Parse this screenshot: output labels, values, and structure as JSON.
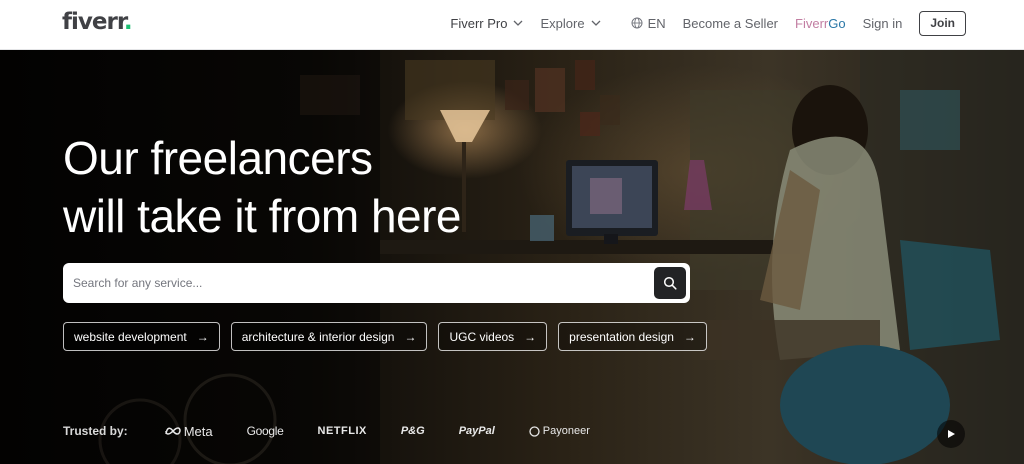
{
  "header": {
    "logo_text": "fiverr",
    "logo_dot": ".",
    "nav": {
      "pro": "Fiverr Pro",
      "explore": "Explore",
      "language": "EN",
      "become_seller": "Become a Seller",
      "go_part1": "Fiverr",
      "go_part2": " Go",
      "sign_in": "Sign in",
      "join": "Join"
    }
  },
  "hero": {
    "headline_line1": "Our freelancers",
    "headline_line2": "will take it from here",
    "search": {
      "placeholder": "Search for any service...",
      "value": ""
    },
    "chips": [
      {
        "label": "website development",
        "arrow": "→"
      },
      {
        "label": "architecture & interior design",
        "arrow": "→"
      },
      {
        "label": "UGC videos",
        "arrow": "→"
      },
      {
        "label": "presentation design",
        "arrow": "→"
      }
    ],
    "trusted": {
      "label": "Trusted by:",
      "brands": [
        "Meta",
        "Google",
        "NETFLIX",
        "P&G",
        "PayPal",
        "Payoneer"
      ]
    }
  },
  "colors": {
    "brand_green": "#1dbf73",
    "text_dark": "#404145",
    "go_pink": "#c27ea2",
    "go_blue": "#2a77a7"
  },
  "icons": [
    "chevron-down-icon",
    "globe-icon",
    "search-icon",
    "arrow-right-icon",
    "meta-logo-icon",
    "payoneer-logo-icon",
    "play-icon"
  ]
}
